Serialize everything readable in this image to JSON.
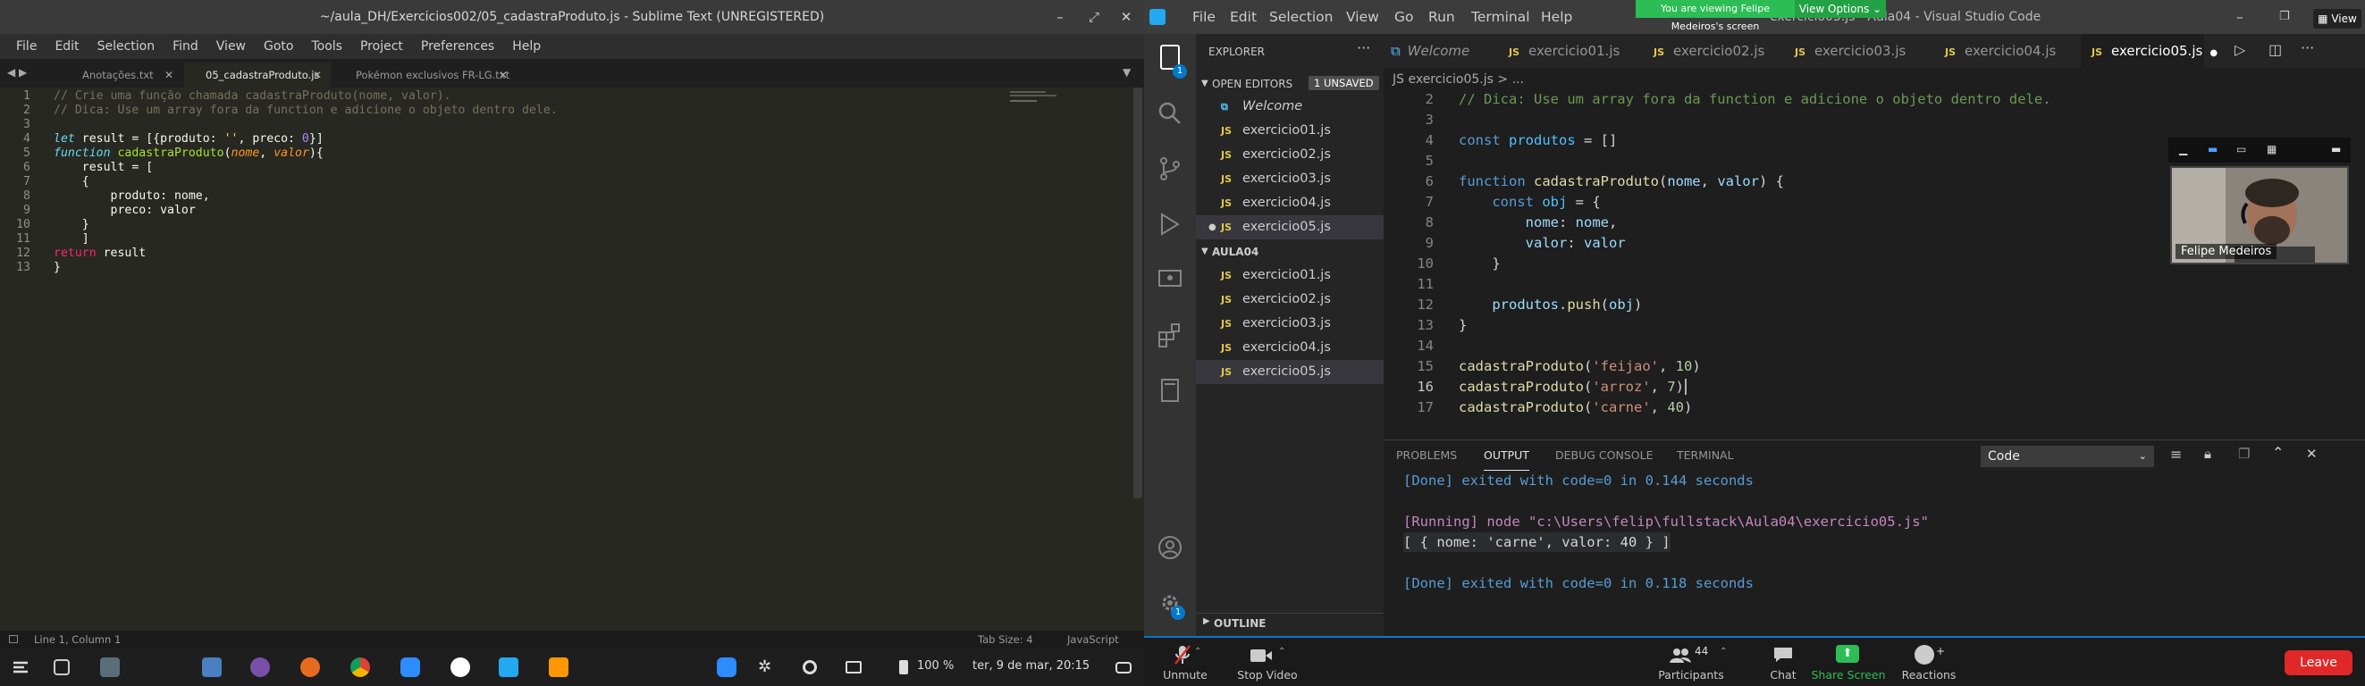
{
  "sublime": {
    "title": "~/aula_DH/Exercicios002/05_cadastraProduto.js - Sublime Text (UNREGISTERED)",
    "menu": [
      "File",
      "Edit",
      "Selection",
      "Find",
      "View",
      "Goto",
      "Tools",
      "Project",
      "Preferences",
      "Help"
    ],
    "tabs": [
      "Anotações.txt",
      "05_cadastraProduto.js",
      "Pokémon exclusivos FR-LG.txt"
    ],
    "line_numbers": [
      "1",
      "2",
      "3",
      "4",
      "5",
      "6",
      "7",
      "8",
      "9",
      "10",
      "11",
      "12",
      "13"
    ],
    "code": {
      "l1": "// Crie uma função chamada cadastraProduto(nome, valor).",
      "l2": "// Dica: Use um array fora da function e adicione o objeto dentro dele.",
      "l4a": "let",
      "l4b": " result = [{produto: ",
      "l4c": "''",
      "l4d": ", preco: ",
      "l4e": "0",
      "l4f": "}]",
      "l5a": "function",
      "l5b": " cadastraProduto",
      "l5c": "(",
      "l5d": "nome",
      "l5e": ", ",
      "l5f": "valor",
      "l5g": "){",
      "l6": "    result = [",
      "l7": "    {",
      "l8": "        produto: nome,",
      "l9": "        preco: valor",
      "l10": "    }",
      "l11": "    ]",
      "l12a": "return",
      "l12b": " result",
      "l13": "}"
    },
    "status_left": "Line 1, Column 1",
    "status_tab": "Tab Size: 4",
    "status_lang": "JavaScript"
  },
  "taskbar": {
    "battery": "100 %",
    "datetime": "ter, 9 de mar, 20:15"
  },
  "vscode": {
    "menu": [
      "File",
      "Edit",
      "Selection",
      "View",
      "Go",
      "Run",
      "Terminal",
      "Help"
    ],
    "title_behind": "exercicio05.js - Aula04 - Visual Studio Code",
    "explorer_title": "EXPLORER",
    "open_editors": "OPEN EDITORS",
    "unsaved": "1 UNSAVED",
    "open_files": [
      "Welcome",
      "exercicio01.js",
      "exercicio02.js",
      "exercicio03.js",
      "exercicio04.js",
      "exercicio05.js"
    ],
    "folder": "AULA04",
    "folder_files": [
      "exercicio01.js",
      "exercicio02.js",
      "exercicio03.js",
      "exercicio04.js",
      "exercicio05.js"
    ],
    "outline": "OUTLINE",
    "js_label": "JS",
    "tabs": [
      "Welcome",
      "exercicio01.js",
      "exercicio02.js",
      "exercicio03.js",
      "exercicio04.js",
      "exercicio05.js"
    ],
    "breadcrumb": "JS exercicio05.js > ...",
    "line_numbers": [
      "2",
      "3",
      "4",
      "5",
      "6",
      "7",
      "8",
      "9",
      "10",
      "11",
      "12",
      "13",
      "14",
      "15",
      "16",
      "17"
    ],
    "code": {
      "l2": "// Dica: Use um array fora da function e adicione o objeto dentro dele.",
      "l4a": "const",
      "l4b": " produtos",
      "l4c": " = []",
      "l6a": "function",
      "l6b": " cadastraProduto",
      "l6c": "(",
      "l6d": "nome",
      "l6e": ", ",
      "l6f": "valor",
      "l6g": ") {",
      "l7a": "    const",
      "l7b": " obj",
      "l7c": " = {",
      "l8a": "        nome",
      "l8b": ": ",
      "l8c": "nome",
      "l8d": ",",
      "l9a": "        valor",
      "l9b": ": ",
      "l9c": "valor",
      "l10": "    }",
      "l12a": "    produtos",
      "l12b": ".",
      "l12c": "push",
      "l12d": "(",
      "l12e": "obj",
      "l12f": ")",
      "l13": "}",
      "l15a": "cadastraProduto",
      "l15b": "(",
      "l15c": "'feijao'",
      "l15d": ", ",
      "l15e": "10",
      "l15f": ")",
      "l16a": "cadastraProduto",
      "l16b": "(",
      "l16c": "'arroz'",
      "l16d": ", ",
      "l16e": "7",
      "l16f": ")",
      "l17a": "cadastraProduto",
      "l17b": "(",
      "l17c": "'carne'",
      "l17d": ", ",
      "l17e": "40",
      "l17f": ")"
    },
    "panel_tabs": [
      "PROBLEMS",
      "OUTPUT",
      "DEBUG CONSOLE",
      "TERMINAL"
    ],
    "output_channel": "Code",
    "output": {
      "o1": "[Done] exited with code=0 in 0.144 seconds",
      "o2": "[Running] node \"c:\\Users\\felip\\fullstack\\Aula04\\exercicio05.js\"",
      "o3": "[ { nome: 'carne', valor: 40 } ]",
      "o4": "[Done] exited with code=0 in 0.118 seconds"
    }
  },
  "zoom": {
    "banner": "You are viewing Felipe Medeiros's screen",
    "view_options": "View Options",
    "view": "View",
    "participant_name": "Felipe Medeiros",
    "unmute": "Unmute",
    "stop_video": "Stop Video",
    "participants": "Participants",
    "participants_count": "44",
    "chat": "Chat",
    "share_screen": "Share Screen",
    "reactions": "Reactions",
    "leave": "Leave",
    "settings_badge": "1"
  },
  "colors": {
    "sublime_bg": "#272822",
    "vscode_bg": "#1e1e1e",
    "zoom_green": "#2dbd55",
    "leave_red": "#e02828",
    "accent_blue": "#007acc"
  }
}
